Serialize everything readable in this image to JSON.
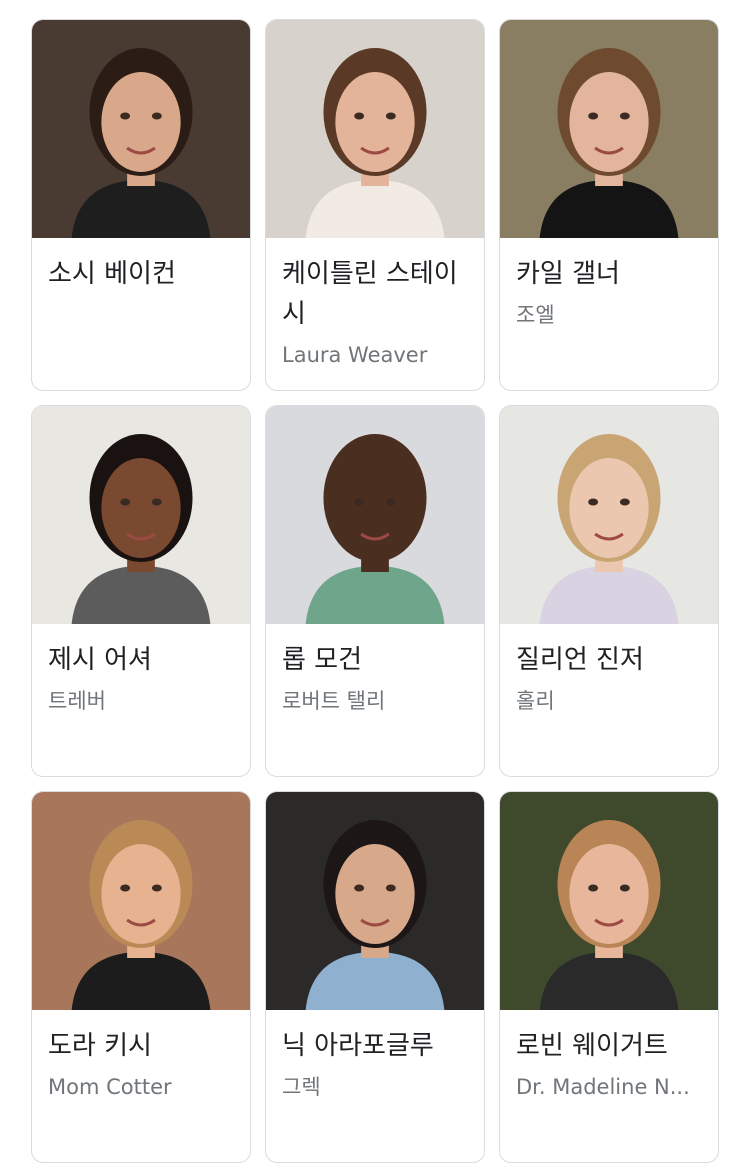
{
  "cast": [
    {
      "name": "소시 베이컨",
      "role": "",
      "bg": "#4a3b32",
      "skin": "#d9a88a",
      "hair": "#2b1d16",
      "shirt": "#1e1e1e"
    },
    {
      "name": "케이틀린 스테이시",
      "role": "Laura Weaver",
      "bg": "#d8d2cc",
      "skin": "#e3b49a",
      "hair": "#5a3a26",
      "shirt": "#f2ebe5"
    },
    {
      "name": "카일 갤너",
      "role": "조엘",
      "bg": "#8a7e62",
      "skin": "#e2b59c",
      "hair": "#6e4b2e",
      "shirt": "#141414"
    },
    {
      "name": "제시 어셔",
      "role": "트레버",
      "bg": "#e9e7e2",
      "skin": "#7a4a30",
      "hair": "#1a1210",
      "shirt": "#5c5c5c"
    },
    {
      "name": "롭 모건",
      "role": "로버트 탤리",
      "bg": "#d9dade",
      "skin": "#4a2e20",
      "hair": "#4a2e20",
      "shirt": "#6fa58a"
    },
    {
      "name": "질리언 진저",
      "role": "홀리",
      "bg": "#e6e6e3",
      "skin": "#ecc7af",
      "hair": "#c9a574",
      "shirt": "#d8d2e2"
    },
    {
      "name": "도라 키시",
      "role": "Mom Cotter",
      "bg": "#a8765a",
      "skin": "#e7b28f",
      "hair": "#b98a55",
      "shirt": "#1c1c1c"
    },
    {
      "name": "닉 아라포글루",
      "role": "그렉",
      "bg": "#2c2a28",
      "skin": "#d8a88a",
      "hair": "#1c1716",
      "shirt": "#8fb0cf"
    },
    {
      "name": "로빈 웨이거트",
      "role": "Dr. Madeline N...",
      "bg": "#3f4a2c",
      "skin": "#e8b69a",
      "hair": "#b98556",
      "shirt": "#2a2a2a"
    }
  ]
}
